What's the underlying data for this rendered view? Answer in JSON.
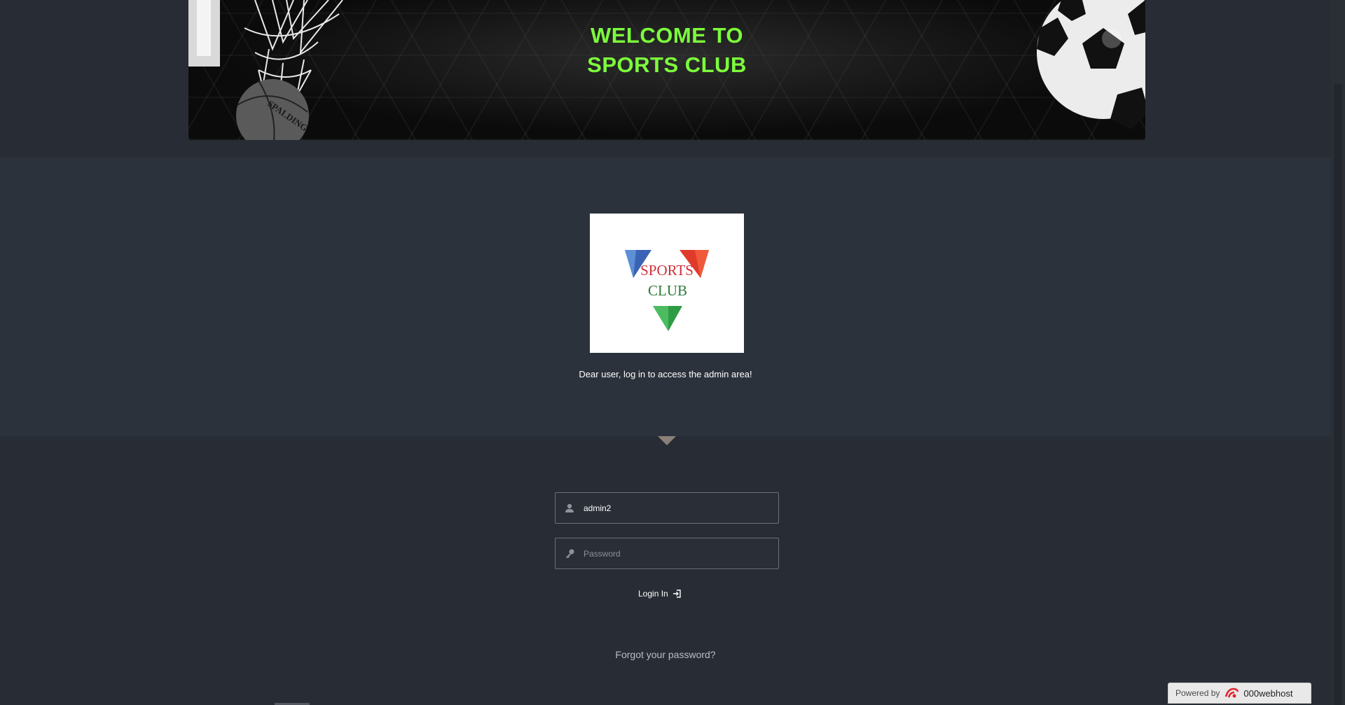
{
  "banner": {
    "title_line1": "WELCOME TO",
    "title_line2": "SPORTS CLUB",
    "basketball_text": "SPALDING",
    "title_color": "#7cfc3c"
  },
  "logo": {
    "line1": "SPORTS",
    "line2": "CLUB",
    "icons": [
      "logo-blue-triangle",
      "logo-red-triangle",
      "logo-green-triangle"
    ]
  },
  "greeting": "Dear user, log in to access the admin area!",
  "form": {
    "username_value": "admin2",
    "username_icon": "user-icon",
    "password_placeholder": "Password",
    "password_icon": "key-icon",
    "login_label": "Login In",
    "login_icon": "sign-in-icon"
  },
  "forgot_label": "Forgot your password?",
  "powered": {
    "prefix": "Powered by",
    "brand": "000webhost"
  }
}
